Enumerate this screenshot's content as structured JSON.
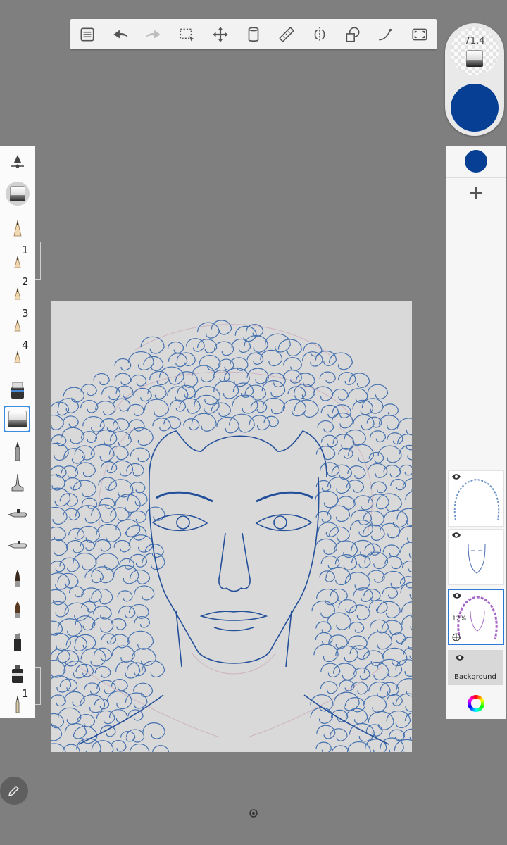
{
  "toolbar": {
    "items": [
      "layers-list",
      "undo",
      "redo",
      "selection",
      "transform",
      "fill-bucket",
      "ruler",
      "symmetry",
      "shape",
      "curve",
      "fullscreen"
    ]
  },
  "brush_panel": {
    "size_value": "71.4",
    "current_color": "#063f94"
  },
  "brush_library": {
    "tools": [
      {
        "icon": "brush-properties-icon",
        "label": ""
      },
      {
        "icon": "eraser-preview-icon",
        "label": ""
      },
      {
        "icon": "pencil-icon",
        "label": ""
      },
      {
        "icon": "pencil-icon",
        "label": "1"
      },
      {
        "icon": "pencil-icon",
        "label": "2"
      },
      {
        "icon": "pencil-icon",
        "label": "3"
      },
      {
        "icon": "pencil-icon",
        "label": "4"
      },
      {
        "icon": "marker-icon",
        "label": ""
      },
      {
        "icon": "eraser-icon",
        "label": ""
      },
      {
        "icon": "ink-pen-icon",
        "label": ""
      },
      {
        "icon": "fountain-pen-icon",
        "label": ""
      },
      {
        "icon": "airbrush-icon",
        "label": ""
      },
      {
        "icon": "airbrush-fine-icon",
        "label": ""
      },
      {
        "icon": "paintbrush-icon",
        "label": ""
      },
      {
        "icon": "paintbrush-wide-icon",
        "label": ""
      },
      {
        "icon": "chisel-marker-icon",
        "label": ""
      },
      {
        "icon": "felt-marker-icon",
        "label": ""
      },
      {
        "icon": "fine-brush-icon",
        "label": "1"
      }
    ],
    "selected_index": 8
  },
  "layers": {
    "items": [
      {
        "name": "layer-1",
        "opacity": ""
      },
      {
        "name": "layer-2",
        "opacity": ""
      },
      {
        "name": "layer-3",
        "opacity": "12%"
      }
    ],
    "background_label": "Background",
    "layer_color": "#063f94"
  }
}
